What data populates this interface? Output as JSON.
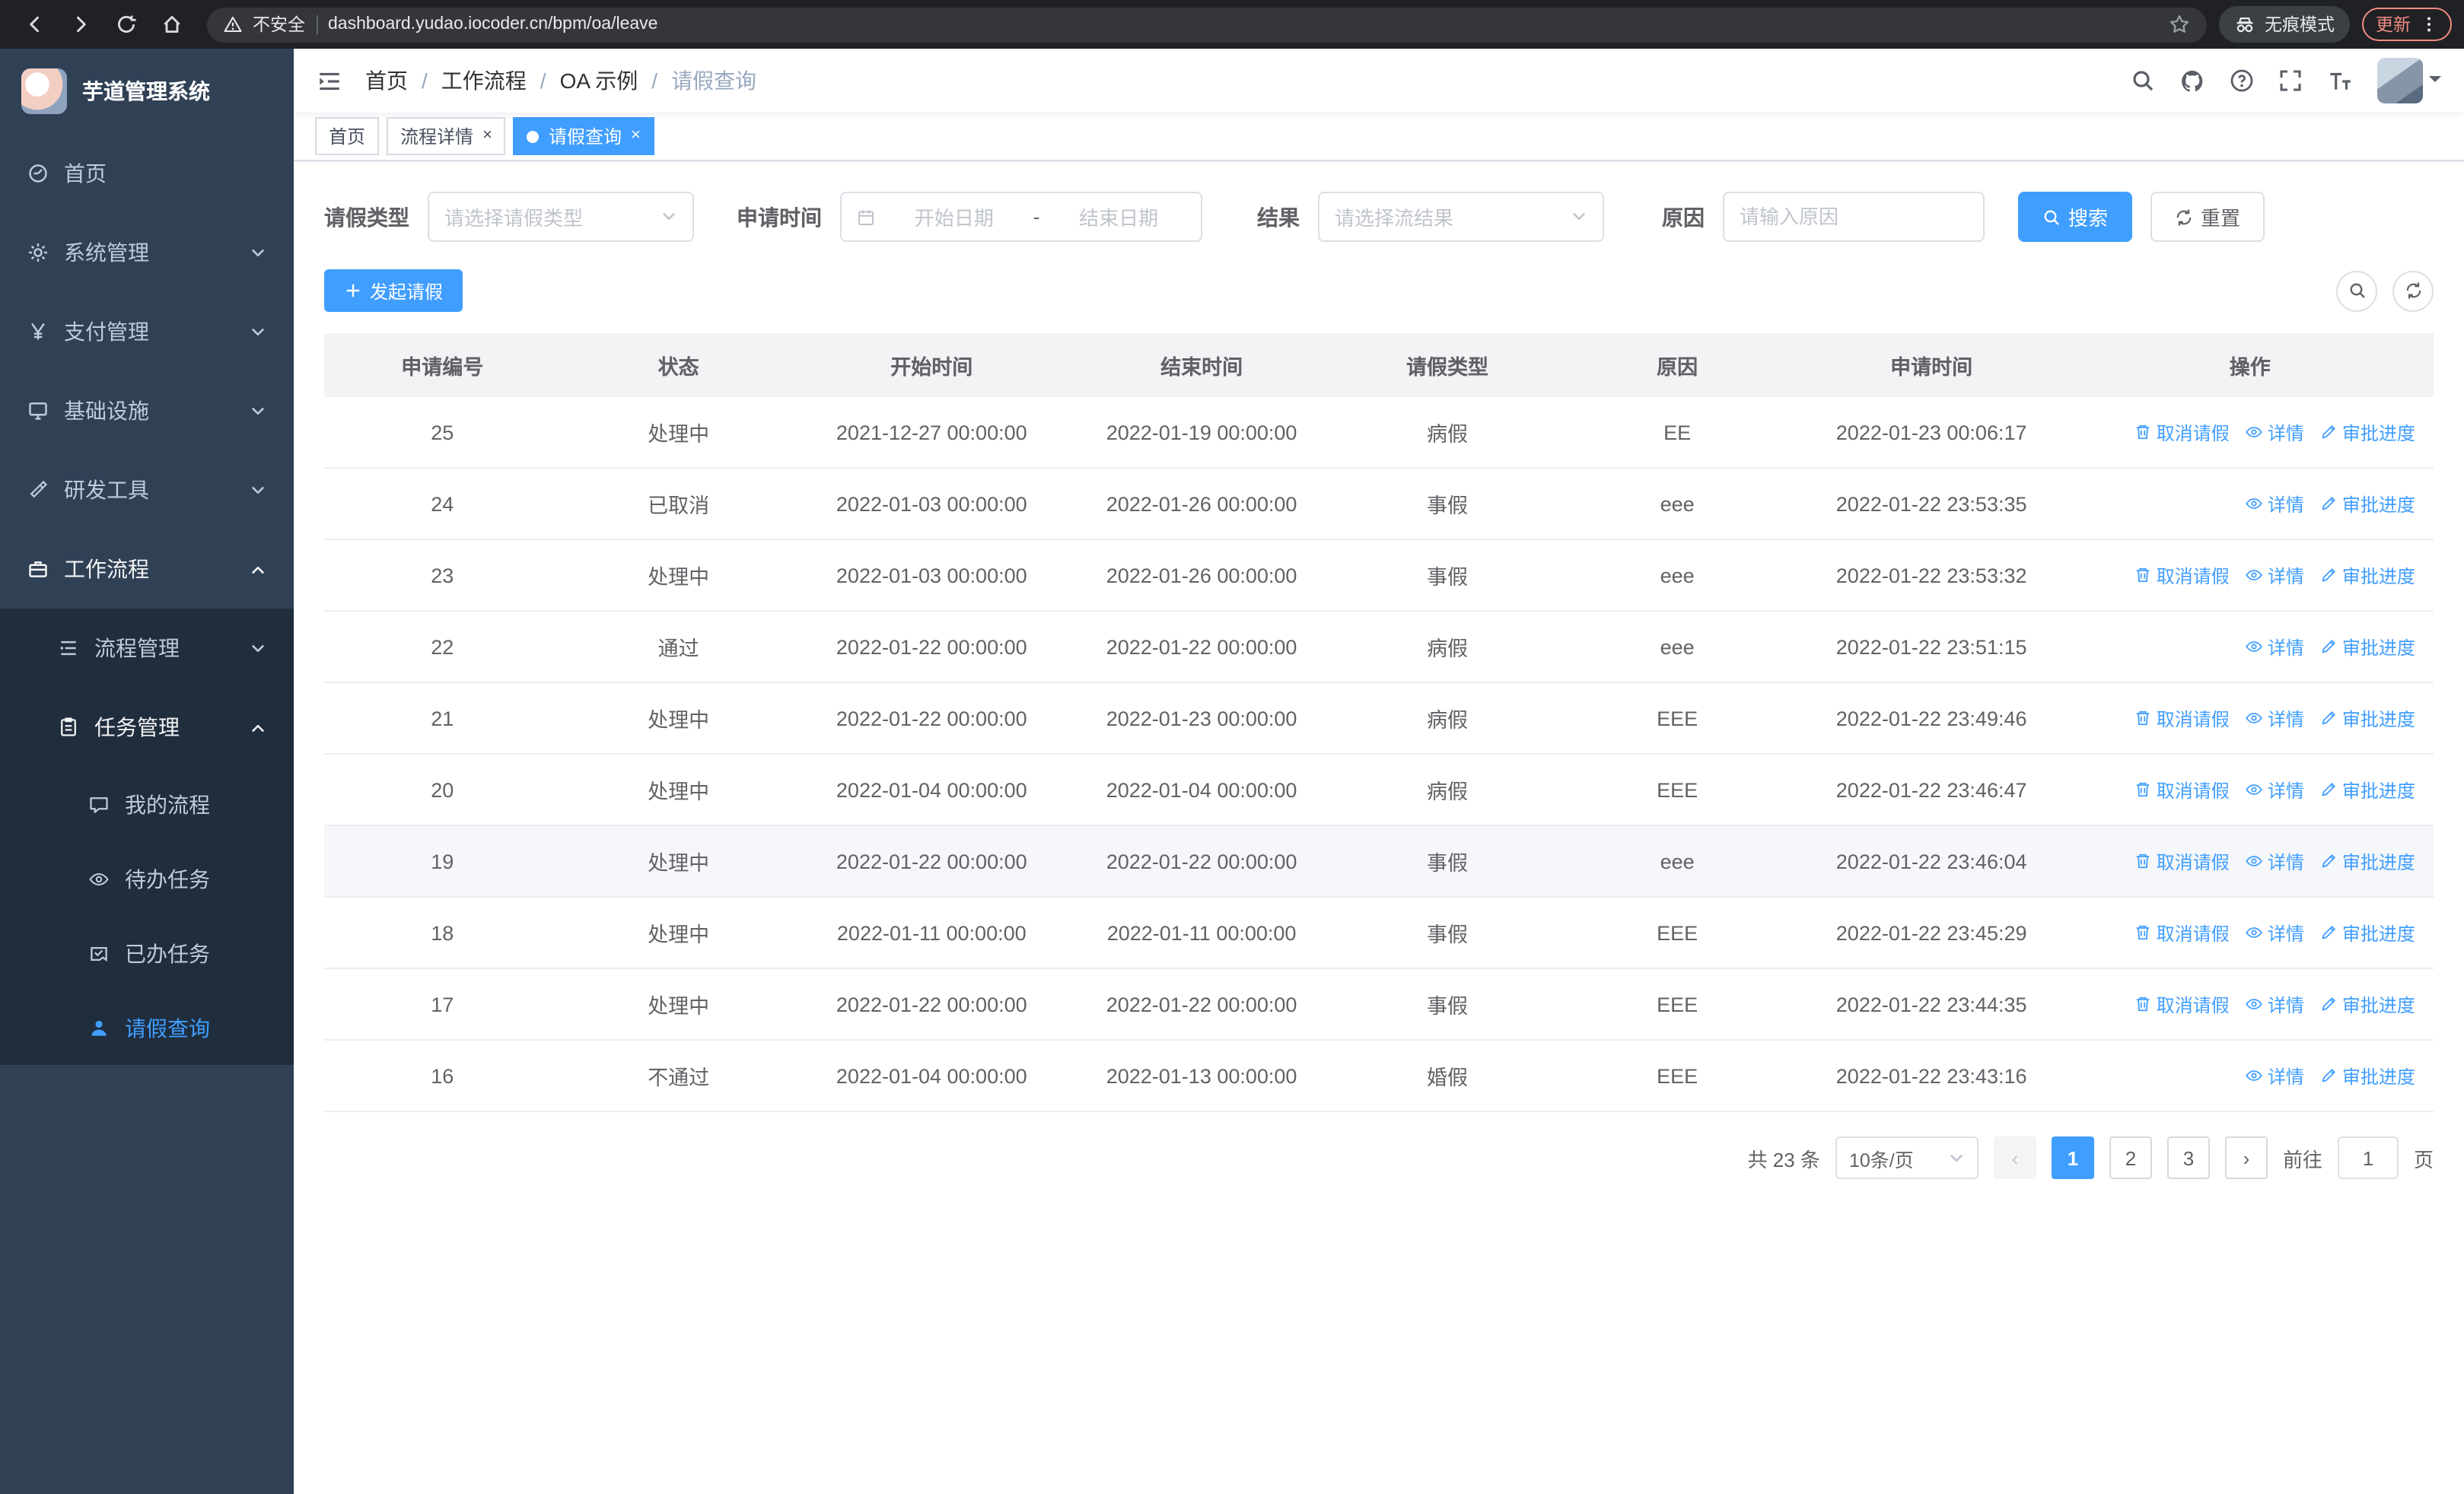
{
  "colors": {
    "accent": "#409eff",
    "sidebar_bg": "#304156",
    "sidebar_submenu_bg": "#1f2d3d",
    "sidebar_text": "#bfcbd9",
    "table_header_bg": "#f2f3f5",
    "browser_bar_bg": "#202124",
    "update_warn": "#f28b82"
  },
  "icons": {
    "close": "×",
    "prev_page": "‹",
    "next_page": "›"
  },
  "browser": {
    "security_label": "不安全",
    "url": "dashboard.yudao.iocoder.cn/bpm/oa/leave",
    "incognito_label": "无痕模式",
    "update_label": "更新"
  },
  "sidebar": {
    "app_title": "芋道管理系统",
    "items": [
      {
        "label": "首页"
      },
      {
        "label": "系统管理"
      },
      {
        "label": "支付管理"
      },
      {
        "label": "基础设施"
      },
      {
        "label": "研发工具"
      },
      {
        "label": "工作流程"
      }
    ],
    "workflow_children": [
      {
        "label": "流程管理"
      },
      {
        "label": "任务管理"
      }
    ],
    "task_children": [
      {
        "label": "我的流程"
      },
      {
        "label": "待办任务"
      },
      {
        "label": "已办任务"
      },
      {
        "label": "请假查询"
      }
    ]
  },
  "header": {
    "breadcrumb": [
      "首页",
      "工作流程",
      "OA 示例",
      "请假查询"
    ],
    "breadcrumb_separator": "/"
  },
  "tabs": [
    {
      "label": "首页"
    },
    {
      "label": "流程详情"
    },
    {
      "label": "请假查询"
    }
  ],
  "filters": {
    "leave_type_label": "请假类型",
    "leave_type_placeholder": "请选择请假类型",
    "apply_time_label": "申请时间",
    "start_date_placeholder": "开始日期",
    "date_separator": "-",
    "end_date_placeholder": "结束日期",
    "result_label": "结果",
    "result_placeholder": "请选择流结果",
    "reason_label": "原因",
    "reason_placeholder": "请输入原因",
    "search_button": "搜索",
    "reset_button": "重置"
  },
  "toolbar": {
    "create_button": "发起请假"
  },
  "table": {
    "columns": [
      "申请编号",
      "状态",
      "开始时间",
      "结束时间",
      "请假类型",
      "原因",
      "申请时间",
      "操作"
    ],
    "actions": {
      "cancel": "取消请假",
      "detail": "详情",
      "progress": "审批进度"
    },
    "rows": [
      {
        "id": "25",
        "status": "处理中",
        "start": "2021-12-27 00:00:00",
        "end": "2022-01-19 00:00:00",
        "type": "病假",
        "reason": "EE",
        "applied": "2022-01-23 00:06:17",
        "cancelable": true
      },
      {
        "id": "24",
        "status": "已取消",
        "start": "2022-01-03 00:00:00",
        "end": "2022-01-26 00:00:00",
        "type": "事假",
        "reason": "eee",
        "applied": "2022-01-22 23:53:35",
        "cancelable": false
      },
      {
        "id": "23",
        "status": "处理中",
        "start": "2022-01-03 00:00:00",
        "end": "2022-01-26 00:00:00",
        "type": "事假",
        "reason": "eee",
        "applied": "2022-01-22 23:53:32",
        "cancelable": true
      },
      {
        "id": "22",
        "status": "通过",
        "start": "2022-01-22 00:00:00",
        "end": "2022-01-22 00:00:00",
        "type": "病假",
        "reason": "eee",
        "applied": "2022-01-22 23:51:15",
        "cancelable": false
      },
      {
        "id": "21",
        "status": "处理中",
        "start": "2022-01-22 00:00:00",
        "end": "2022-01-23 00:00:00",
        "type": "病假",
        "reason": "EEE",
        "applied": "2022-01-22 23:49:46",
        "cancelable": true
      },
      {
        "id": "20",
        "status": "处理中",
        "start": "2022-01-04 00:00:00",
        "end": "2022-01-04 00:00:00",
        "type": "病假",
        "reason": "EEE",
        "applied": "2022-01-22 23:46:47",
        "cancelable": true
      },
      {
        "id": "19",
        "status": "处理中",
        "start": "2022-01-22 00:00:00",
        "end": "2022-01-22 00:00:00",
        "type": "事假",
        "reason": "eee",
        "applied": "2022-01-22 23:46:04",
        "cancelable": true,
        "highlighted": true
      },
      {
        "id": "18",
        "status": "处理中",
        "start": "2022-01-11 00:00:00",
        "end": "2022-01-11 00:00:00",
        "type": "事假",
        "reason": "EEE",
        "applied": "2022-01-22 23:45:29",
        "cancelable": true
      },
      {
        "id": "17",
        "status": "处理中",
        "start": "2022-01-22 00:00:00",
        "end": "2022-01-22 00:00:00",
        "type": "事假",
        "reason": "EEE",
        "applied": "2022-01-22 23:44:35",
        "cancelable": true
      },
      {
        "id": "16",
        "status": "不通过",
        "start": "2022-01-04 00:00:00",
        "end": "2022-01-13 00:00:00",
        "type": "婚假",
        "reason": "EEE",
        "applied": "2022-01-22 23:43:16",
        "cancelable": false
      }
    ]
  },
  "pagination": {
    "total": "共 23 条",
    "page_size": "10条/页",
    "pages": [
      "1",
      "2",
      "3"
    ],
    "active_page": "1",
    "goto_label": "前往",
    "goto_value": "1",
    "page_suffix": "页"
  }
}
